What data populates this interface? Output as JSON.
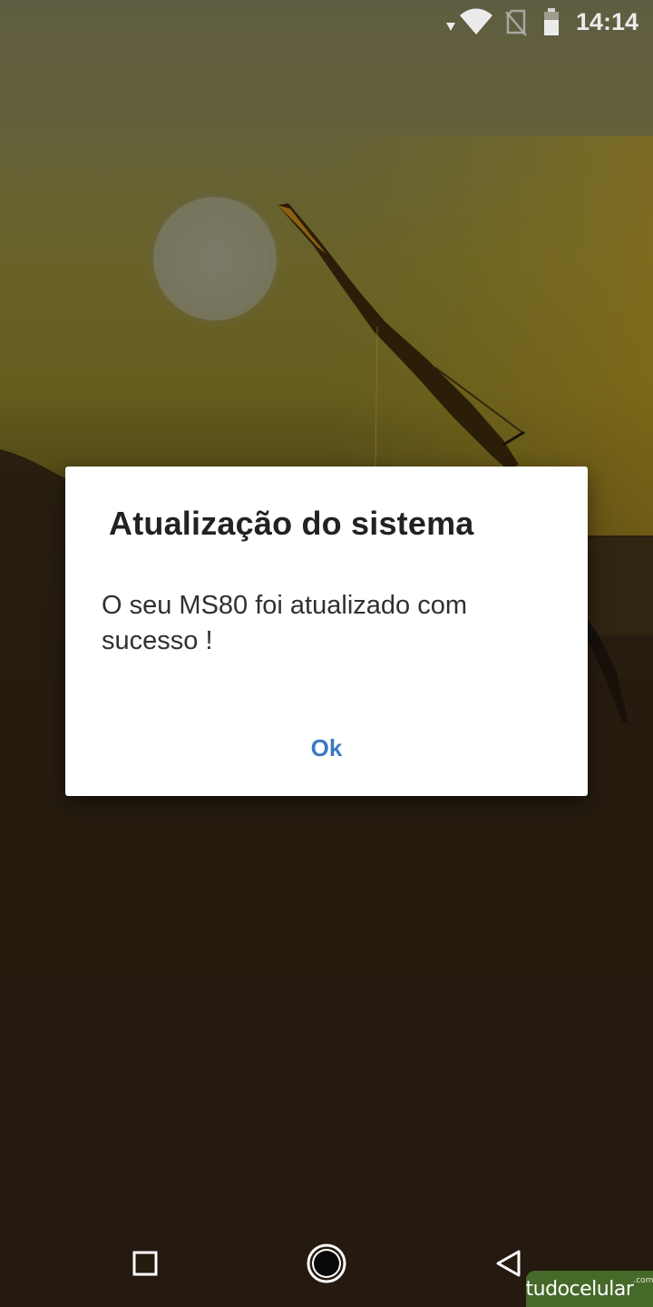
{
  "status_bar": {
    "time": "14:14",
    "icons": [
      "signal-arrow-icon",
      "wifi-icon",
      "no-sim-icon",
      "battery-icon"
    ],
    "icon_color": "#ffffff"
  },
  "dialog": {
    "title": "Atualização do sistema",
    "message": "O seu MS80 foi atualizado com sucesso !",
    "button_label": "Ok",
    "button_color": "#3b78c4"
  },
  "nav_bar": {
    "buttons": [
      "recents-square-icon",
      "home-circle-icon",
      "back-triangle-icon"
    ]
  },
  "watermark": {
    "text": "tudocelular",
    "suffix": ".com"
  }
}
